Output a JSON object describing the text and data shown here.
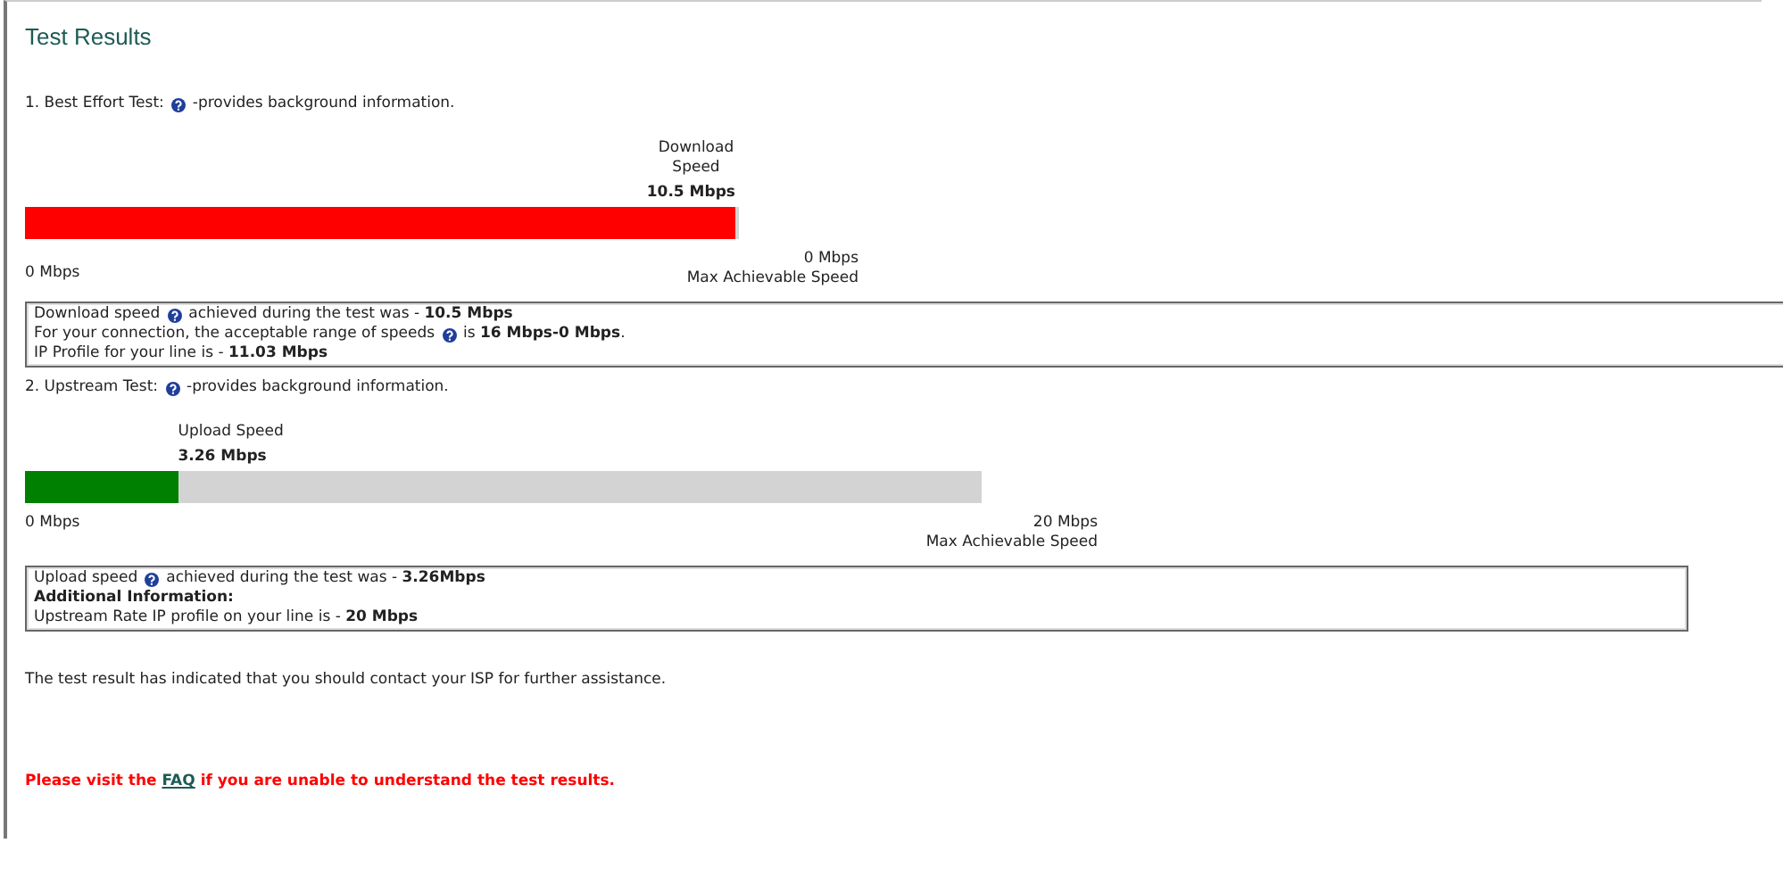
{
  "title": "Test Results",
  "tests": [
    {
      "heading": [
        {
          "kind": "text",
          "text": "1. Best Effort Test:"
        },
        {
          "kind": "help"
        },
        {
          "kind": "text",
          "text": "-provides background information."
        }
      ],
      "bar": {
        "label": "Download Speed",
        "value": "10.5 Mbps",
        "level": 0.995,
        "color": "#ff0000",
        "min": "0 Mbps",
        "max": "0 Mbps",
        "max_caption": "Max Achievable Speed"
      },
      "info": [
        [
          {
            "kind": "text",
            "text": "Download speed"
          },
          {
            "kind": "help"
          },
          {
            "kind": "text",
            "text": "achieved during the test was - **10.5 Mbps**"
          }
        ],
        [
          {
            "kind": "text",
            "text": "For your connection, the acceptable range of speeds"
          },
          {
            "kind": "help"
          },
          {
            "kind": "text",
            "text": "is **16 Mbps-0 Mbps**."
          }
        ],
        [
          {
            "kind": "text",
            "text": "IP Profile for your line is - **11.03 Mbps**"
          }
        ]
      ],
      "kind": "download"
    },
    {
      "heading": [
        {
          "kind": "text",
          "text": "2. Upstream Test:"
        },
        {
          "kind": "help"
        },
        {
          "kind": "text",
          "text": "-provides background information."
        }
      ],
      "bar": {
        "label": "Upload Speed",
        "value": "3.26 Mbps",
        "level": 0.16,
        "color": "#008000",
        "min": "0 Mbps",
        "max": "20 Mbps",
        "max_caption": "Max Achievable Speed"
      },
      "info": [
        [
          {
            "kind": "text",
            "text": "Upload speed"
          },
          {
            "kind": "help"
          },
          {
            "kind": "text",
            "text": "achieved during the test was - **3.26Mbps**"
          }
        ],
        [
          {
            "kind": "text",
            "text": "**Additional Information:**"
          }
        ],
        [
          {
            "kind": "text",
            "text": "Upstream Rate IP profile on your line is - **20 Mbps**"
          }
        ]
      ],
      "kind": "upload"
    }
  ],
  "advice": "The test result has indicated that you should contact your ISP for further assistance.",
  "faq": {
    "before": "Please visit the",
    "link": "FAQ",
    "after": "if you are unable to understand the test results."
  }
}
